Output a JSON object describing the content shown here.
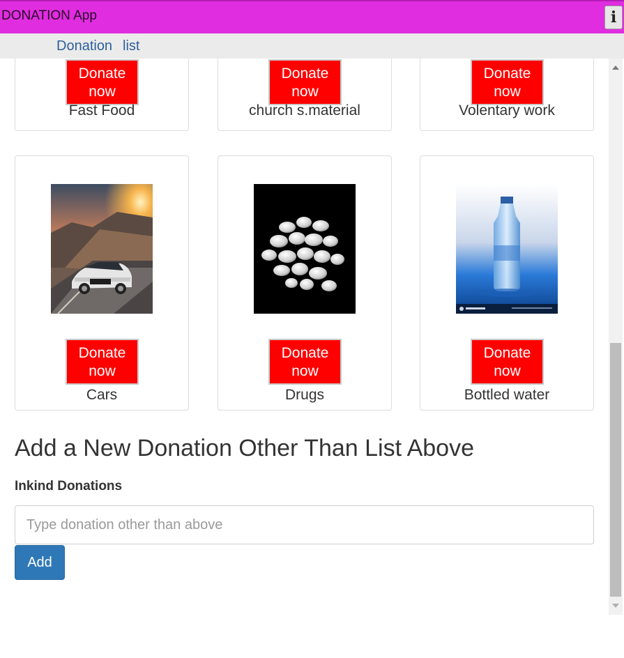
{
  "app": {
    "title": "DONATION App",
    "info_icon": "i"
  },
  "nav": {
    "links": [
      "Donation",
      "list"
    ]
  },
  "donate_label": {
    "line1": "Donate",
    "line2": "now"
  },
  "top_cards": [
    {
      "label": "Fast Food"
    },
    {
      "label": "church s.material"
    },
    {
      "label": "Volentary work"
    }
  ],
  "bottom_cards": [
    {
      "label": "Cars",
      "image": "car-photo"
    },
    {
      "label": "Drugs",
      "image": "pills-photo"
    },
    {
      "label": "Bottled water",
      "image": "water-bottle-photo"
    }
  ],
  "form": {
    "heading": "Add a New Donation Other Than List Above",
    "label": "Inkind Donations",
    "placeholder": "Type donation other than above",
    "value": "",
    "button": "Add"
  },
  "colors": {
    "titlebar": "#e02de0",
    "donate_button": "#ff0000",
    "add_button": "#2f78b7"
  }
}
